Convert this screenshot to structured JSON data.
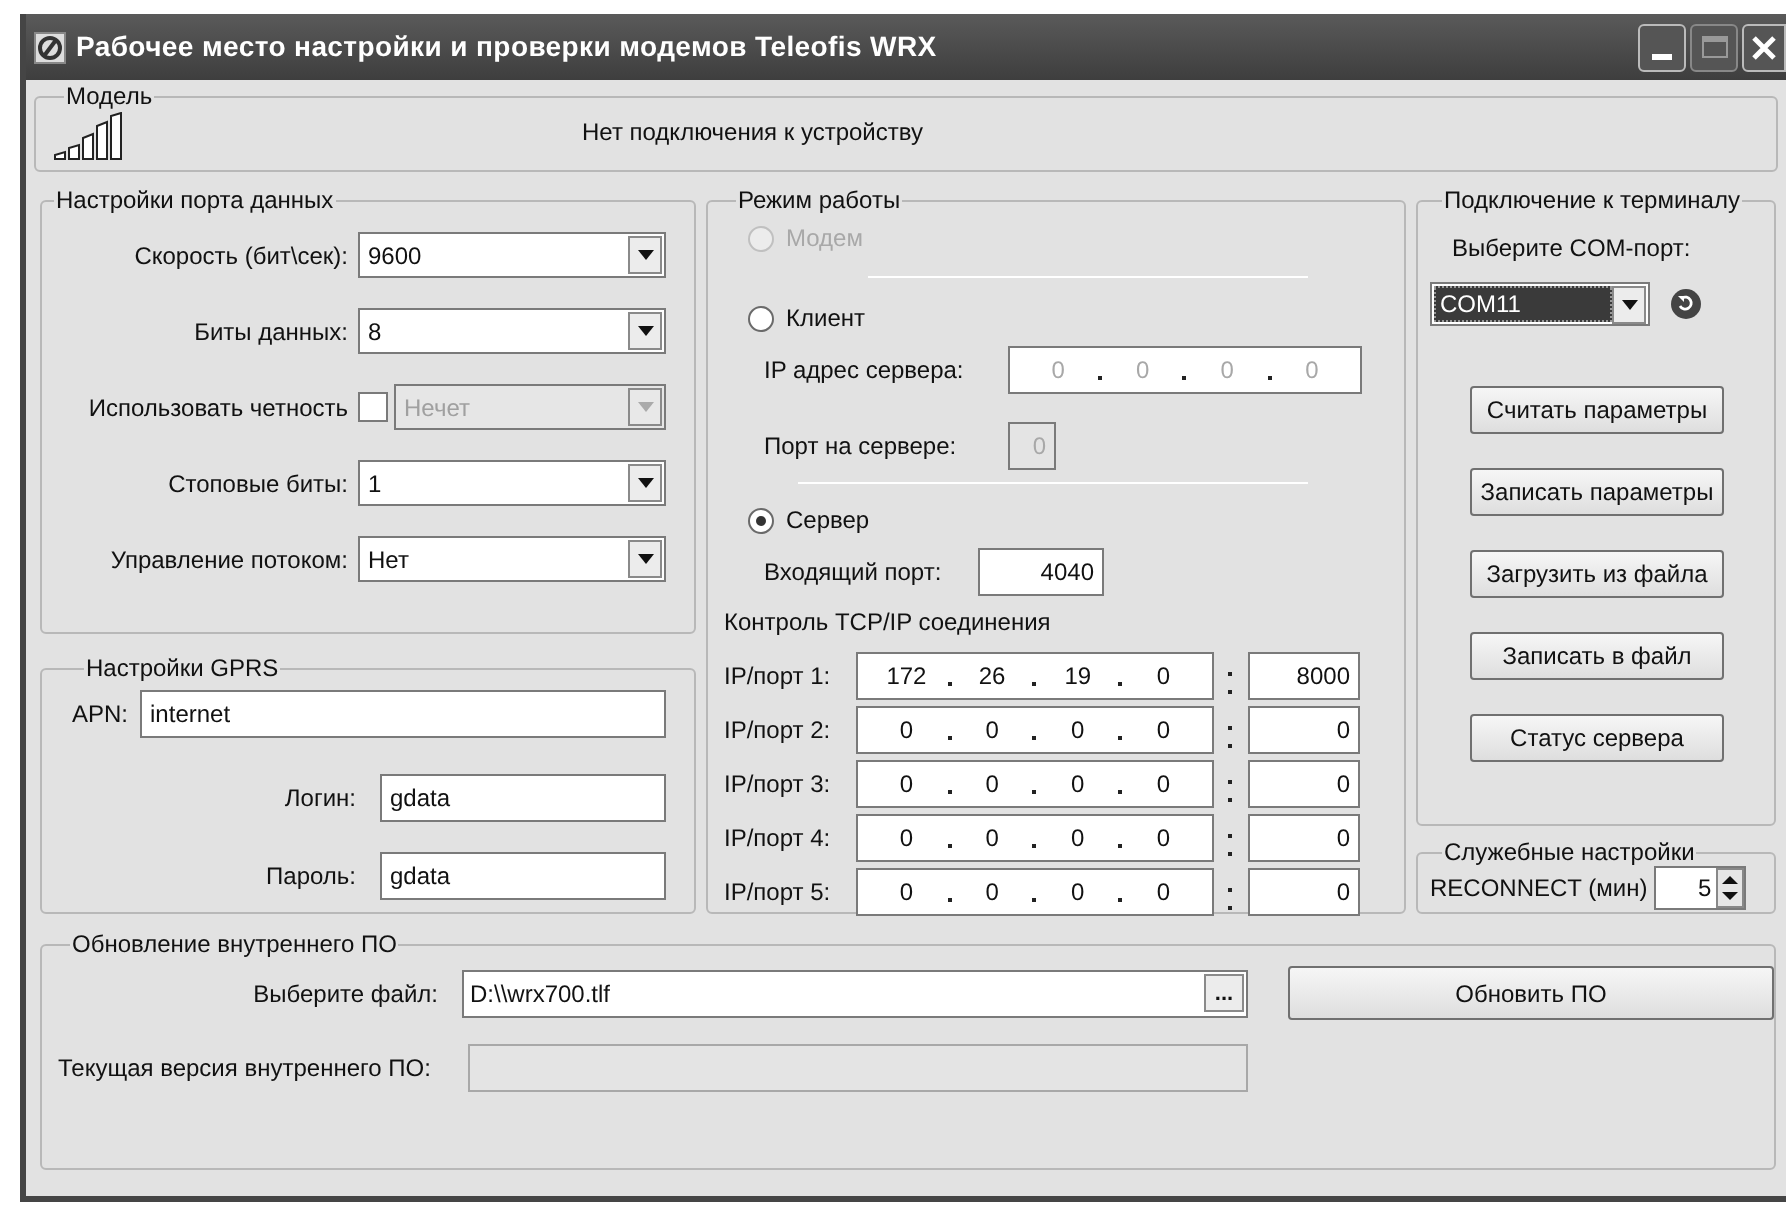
{
  "window": {
    "title": "Рабочее место настройки и проверки модемов Teleofis WRX"
  },
  "model": {
    "legend": "Модель",
    "status": "Нет подключения к устройству"
  },
  "port_settings": {
    "legend": "Настройки порта данных",
    "rows": [
      {
        "kind": "select",
        "label": "Скорость (бит\\сек):",
        "value": "9600",
        "disabled": false
      },
      {
        "kind": "select",
        "label": "Биты данных:",
        "value": "8",
        "disabled": false
      },
      {
        "kind": "checkbox-select",
        "label": "Использовать четность",
        "checked": false,
        "value": "Нечет",
        "disabled": true
      },
      {
        "kind": "select",
        "label": "Стоповые биты:",
        "value": "1",
        "disabled": false
      },
      {
        "kind": "select",
        "label": "Управление потоком:",
        "value": "Нет",
        "disabled": false
      }
    ]
  },
  "gprs": {
    "legend": "Настройки GPRS",
    "apn": {
      "label": "APN:",
      "value": "internet"
    },
    "login": {
      "label": "Логин:",
      "value": "gdata"
    },
    "password": {
      "label": "Пароль:",
      "value": "gdata"
    }
  },
  "mode": {
    "legend": "Режим работы",
    "options": [
      {
        "label": "Модем",
        "selected": false,
        "disabled": true
      },
      {
        "label": "Клиент",
        "selected": false,
        "disabled": false
      },
      {
        "label": "Сервер",
        "selected": true,
        "disabled": false
      }
    ],
    "server_ip": {
      "label": "IP адрес сервера:",
      "octets": [
        "0",
        "0",
        "0",
        "0"
      ],
      "disabled": true
    },
    "server_port": {
      "label": "Порт на сервере:",
      "value": "0",
      "disabled": true
    },
    "incoming_port": {
      "label": "Входящий порт:",
      "value": "4040"
    },
    "tcp_title": "Контроль TCP/IP соединения",
    "tcp_rows": [
      {
        "label": "IP/порт 1:",
        "octets": [
          "172",
          "26",
          "19",
          "0"
        ],
        "port": "8000"
      },
      {
        "label": "IP/порт 2:",
        "octets": [
          "0",
          "0",
          "0",
          "0"
        ],
        "port": "0"
      },
      {
        "label": "IP/порт 3:",
        "octets": [
          "0",
          "0",
          "0",
          "0"
        ],
        "port": "0"
      },
      {
        "label": "IP/порт 4:",
        "octets": [
          "0",
          "0",
          "0",
          "0"
        ],
        "port": "0"
      },
      {
        "label": "IP/порт 5:",
        "octets": [
          "0",
          "0",
          "0",
          "0"
        ],
        "port": "0"
      }
    ]
  },
  "terminal": {
    "legend": "Подключение к терминалу",
    "com_label": "Выберите COM-порт:",
    "com_value": "COM11",
    "buttons": [
      "Считать параметры",
      "Записать параметры",
      "Загрузить из файла",
      "Записать в файл",
      "Статус сервера"
    ]
  },
  "service": {
    "legend": "Служебные настройки",
    "reconnect_label": "RECONNECT (мин)",
    "reconnect_value": "5"
  },
  "firmware": {
    "legend": "Обновление внутреннего ПО",
    "file_label": "Выберите файл:",
    "file_value": "D:\\\\wrx700.tlf",
    "browse": "...",
    "update_button": "Обновить ПО",
    "version_label": "Текущая версия внутреннего ПО:",
    "version_disabled": true
  }
}
